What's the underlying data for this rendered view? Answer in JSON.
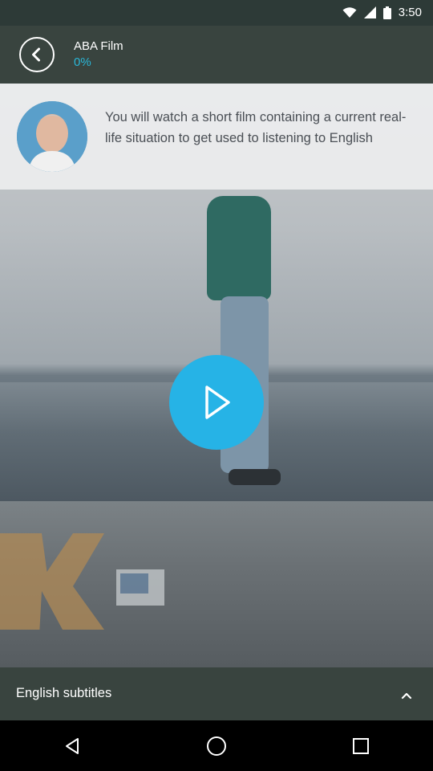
{
  "status_bar": {
    "time": "3:50"
  },
  "header": {
    "title": "ABA Film",
    "progress": "0%"
  },
  "info": {
    "text": "You will watch a short film containing a current real-life situation to get used to listening to English"
  },
  "subtitles": {
    "label": "English subtitles"
  },
  "colors": {
    "accent": "#26b3e6",
    "header_bg": "#39443f",
    "progress_text": "#2ab7d8"
  },
  "icons": {
    "back": "back-arrow-icon",
    "play": "play-icon",
    "subtitle_toggle": "chevron-up-icon",
    "nav_back": "triangle-back-icon",
    "nav_home": "circle-home-icon",
    "nav_recents": "square-recents-icon"
  }
}
